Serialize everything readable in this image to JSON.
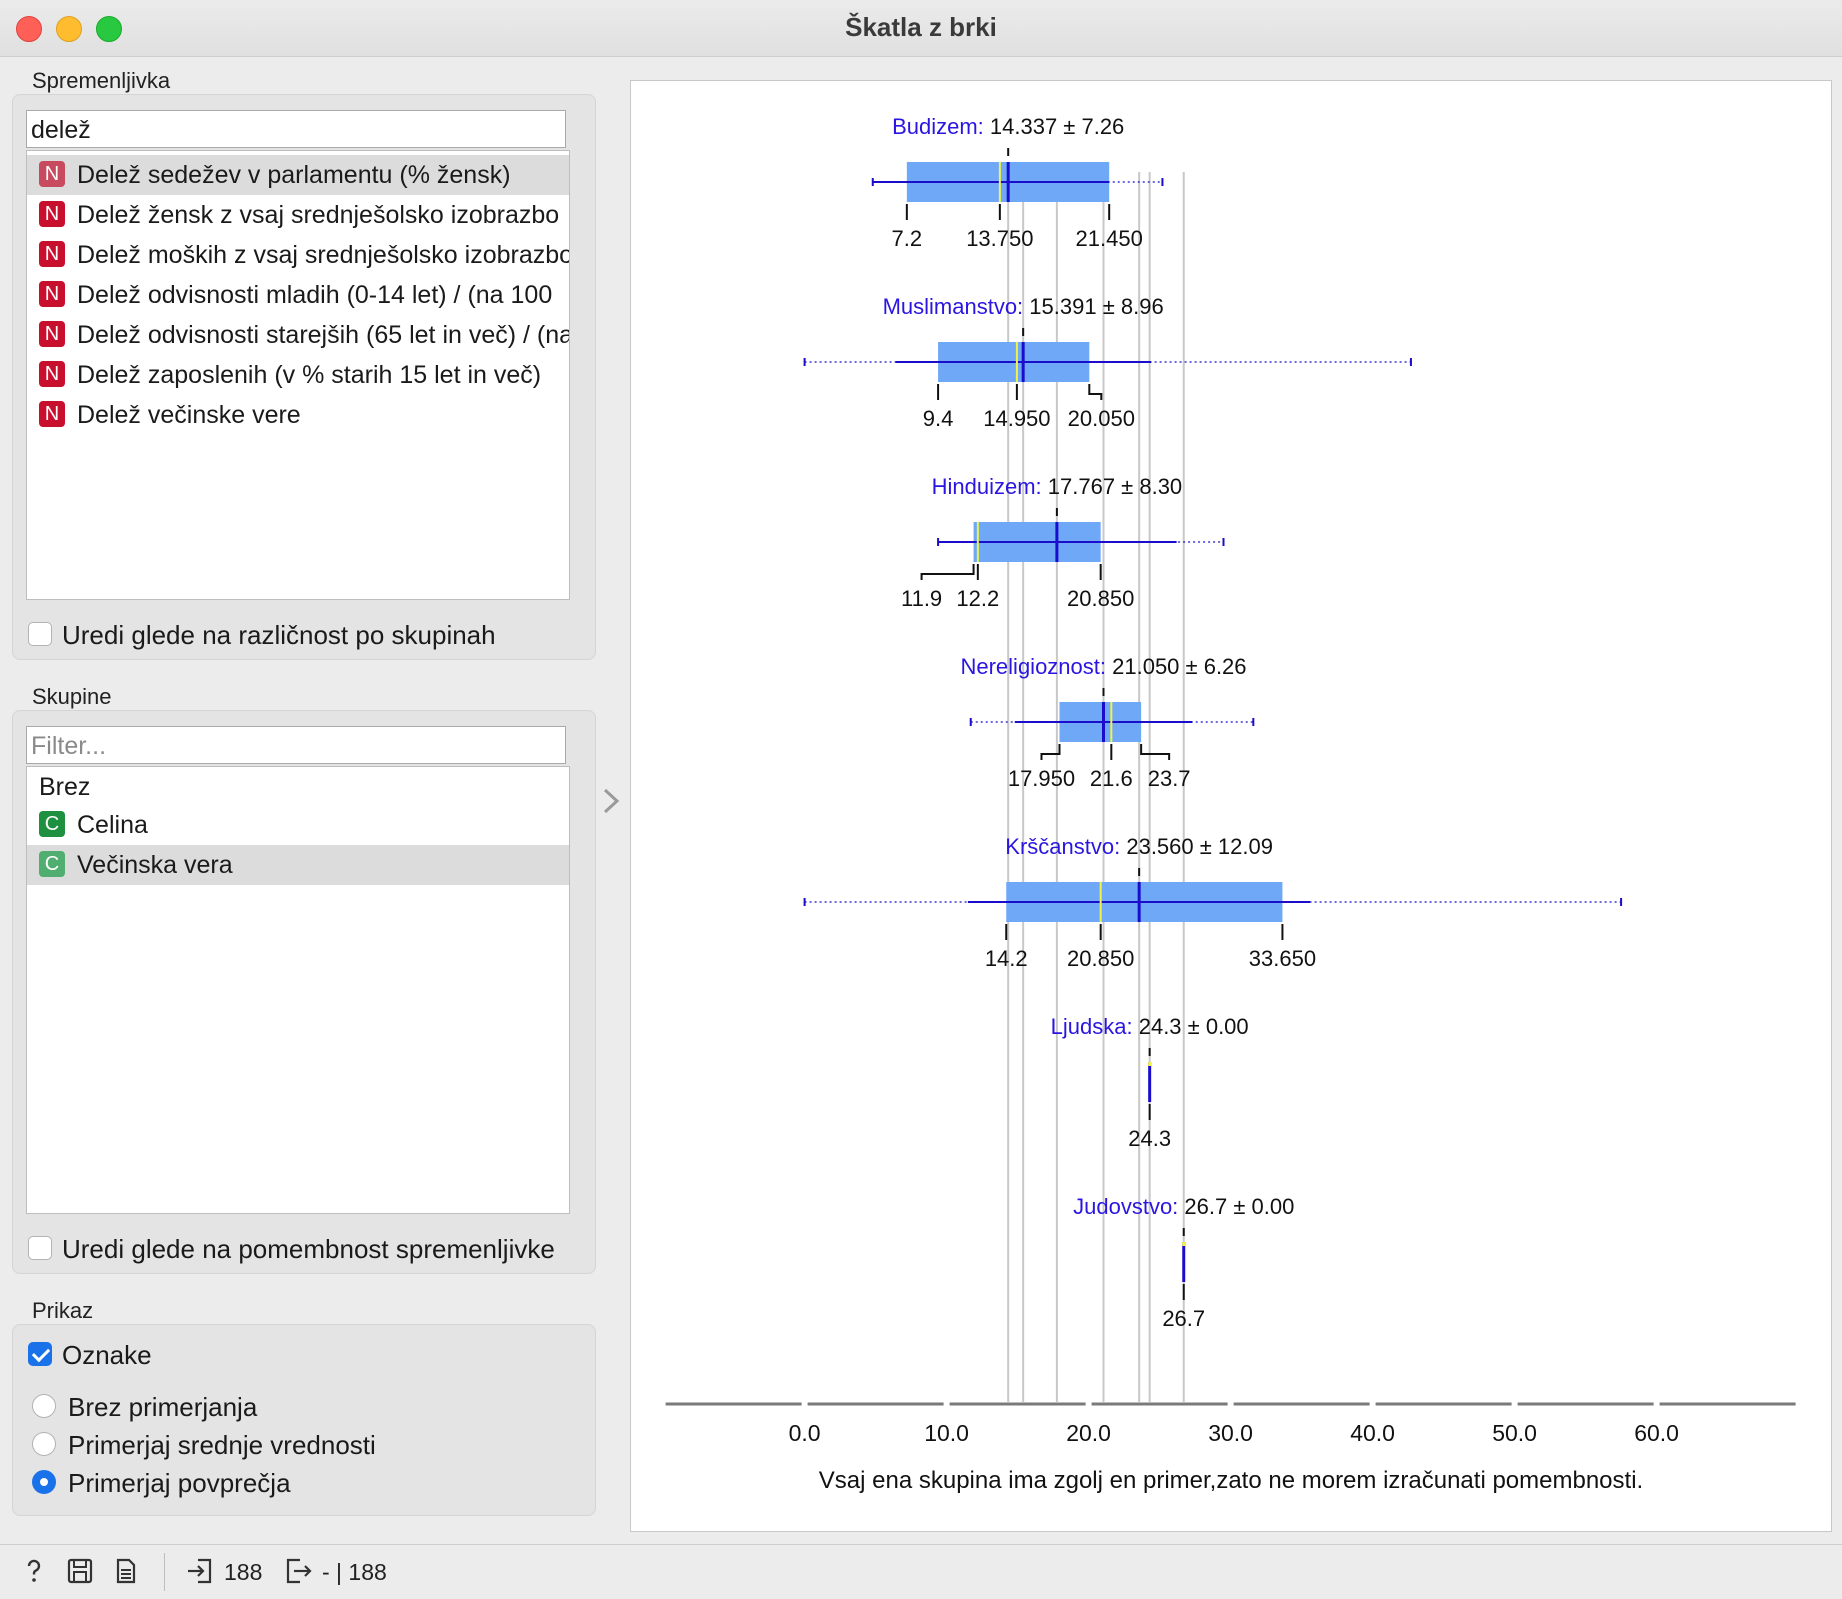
{
  "window": {
    "title": "Škatla z brki"
  },
  "variable": {
    "label": "Spremenljivka",
    "search": "delež",
    "items": [
      "Delež sedežev v parlamentu (% žensk)",
      "Delež žensk z vsaj srednješolsko izobrazbo",
      "Delež moških z vsaj srednješolsko izobrazbo",
      "Delež odvisnosti mladih (0-14 let) / (na 100",
      "Delež odvisnosti starejših (65 let in več) / (na",
      "Delež zaposlenih (v % starih 15 let in več)",
      "Delež večinske vere"
    ],
    "badge": "N",
    "order_checkbox": "Uredi glede na različnost po skupinah"
  },
  "groups": {
    "label": "Skupine",
    "filter_placeholder": "Filter...",
    "none_item": "Brez",
    "items": [
      "Celina",
      "Večinska vera"
    ],
    "badge": "C",
    "order_checkbox": "Uredi glede na pomembnost spremenljivke"
  },
  "display": {
    "label": "Prikaz",
    "labels_checkbox": "Oznake",
    "radios": [
      "Brez primerjanja",
      "Primerjaj srednje vrednosti",
      "Primerjaj povprečja"
    ]
  },
  "status": {
    "input_count": "188",
    "output_count": "- | 188"
  },
  "chart_data": {
    "type": "boxplot",
    "orientation": "horizontal",
    "xlim": [
      -10,
      70
    ],
    "xticks": [
      "0.0",
      "10.0",
      "20.0",
      "30.0",
      "40.0",
      "50.0",
      "60.0"
    ],
    "tick_values": [
      0,
      10,
      20,
      30,
      40,
      50,
      60
    ],
    "footer": "Vsaj ena skupina ima zgolj en primer,zato ne morem izračunati pomembnosti.",
    "colors": {
      "box": "#6fa8f7",
      "mean": "#1a0dcc",
      "median": "#f2f24a",
      "label": "#2a16e0"
    },
    "groups": [
      {
        "name": "Budizem:",
        "stat": "14.337 ± 7.26",
        "mean": 14.337,
        "sd": 7.26,
        "min": 4.8,
        "max": 25.2,
        "q1": 7.2,
        "median": 13.75,
        "q3": 21.45,
        "whisker_low": 4.8,
        "whisker_high": 21.45,
        "labels": [
          "7.2",
          "13.750",
          "21.450"
        ]
      },
      {
        "name": "Muslimanstvo:",
        "stat": "15.391 ± 8.96",
        "mean": 15.391,
        "sd": 8.96,
        "min": 0.0,
        "max": 42.7,
        "q1": 9.4,
        "median": 14.95,
        "q3": 20.05,
        "whisker_low": 6.4,
        "whisker_high": 24.4,
        "labels": [
          "9.4",
          "14.950",
          "20.050"
        ]
      },
      {
        "name": "Hinduizem:",
        "stat": "17.767 ± 8.30",
        "mean": 17.767,
        "sd": 8.3,
        "min": 9.4,
        "max": 29.5,
        "q1": 11.9,
        "median": 12.2,
        "q3": 20.85,
        "whisker_low": 9.4,
        "whisker_high": 26.2,
        "labels": [
          "11.9",
          "12.2",
          "20.850"
        ]
      },
      {
        "name": "Nereligioznost:",
        "stat": "21.050 ± 6.26",
        "mean": 21.05,
        "sd": 6.26,
        "min": 11.7,
        "max": 31.6,
        "q1": 17.95,
        "median": 21.6,
        "q3": 23.7,
        "whisker_low": 14.8,
        "whisker_high": 27.3,
        "labels": [
          "17.950",
          "21.6",
          "23.7"
        ]
      },
      {
        "name": "Krščanstvo:",
        "stat": "23.560 ± 12.09",
        "mean": 23.56,
        "sd": 12.09,
        "min": 0.0,
        "max": 57.5,
        "q1": 14.2,
        "median": 20.85,
        "q3": 33.65,
        "whisker_low": 11.5,
        "whisker_high": 35.6,
        "labels": [
          "14.2",
          "20.850",
          "33.650"
        ]
      },
      {
        "name": "Ljudska:",
        "stat": "24.3 ± 0.00",
        "mean": 24.3,
        "sd": 0,
        "min": 24.3,
        "max": 24.3,
        "q1": 24.3,
        "median": 24.3,
        "q3": 24.3,
        "whisker_low": 24.3,
        "whisker_high": 24.3,
        "labels": [
          "24.3"
        ]
      },
      {
        "name": "Judovstvo:",
        "stat": "26.7 ± 0.00",
        "mean": 26.7,
        "sd": 0,
        "min": 26.7,
        "max": 26.7,
        "q1": 26.7,
        "median": 26.7,
        "q3": 26.7,
        "whisker_low": 26.7,
        "whisker_high": 26.7,
        "labels": [
          "26.7"
        ]
      }
    ]
  }
}
